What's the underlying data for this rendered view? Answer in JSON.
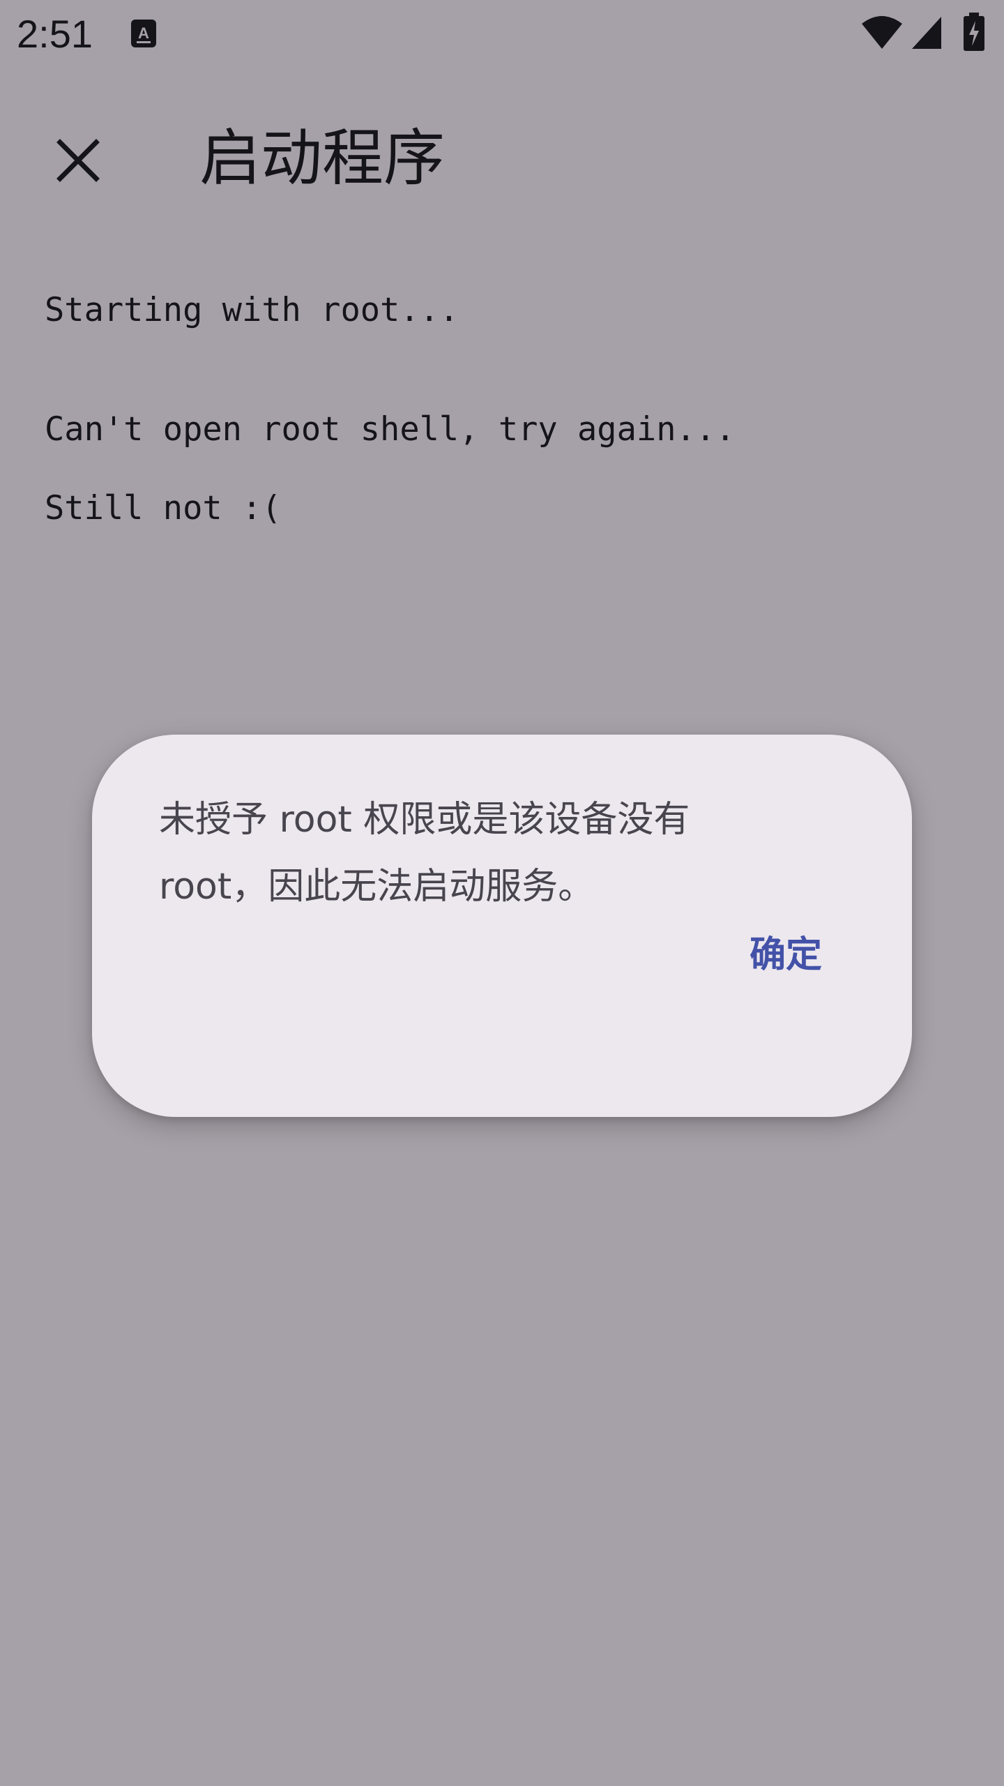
{
  "status_bar": {
    "time": "2:51",
    "icons": [
      "text-input-notification-icon",
      "wifi-icon",
      "cellular-signal-icon",
      "battery-charging-icon"
    ]
  },
  "app_bar": {
    "close_icon": "close-icon",
    "title": "启动程序"
  },
  "console": {
    "lines": [
      "Starting with root...",
      "Can't open root shell, try again...",
      "Still not :("
    ]
  },
  "dialog": {
    "message_line1": "未授予 root 权限或是该设备没有",
    "message_line2": "root，因此无法启动服务。",
    "confirm_label": "确定"
  },
  "colors": {
    "surface": "#fdf8fd",
    "dialog_surface": "#ece8ee",
    "on_surface": "#1c1b1f",
    "dialog_text": "#48454e",
    "accent": "#4352a8",
    "scrim": "rgba(12,8,18,0.36)"
  }
}
